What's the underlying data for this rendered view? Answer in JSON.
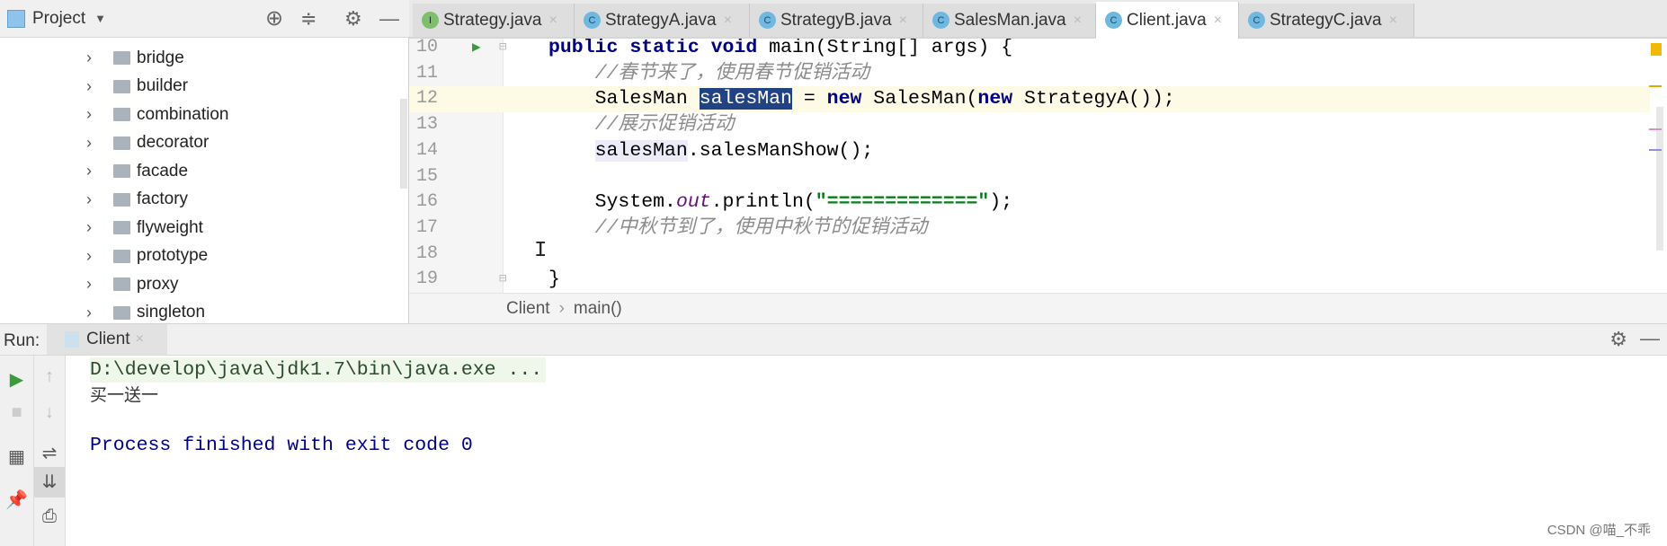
{
  "project": {
    "title": "Project",
    "tree": [
      "bridge",
      "builder",
      "combination",
      "decorator",
      "facade",
      "factory",
      "flyweight",
      "prototype",
      "proxy",
      "singleton"
    ]
  },
  "tabs": [
    {
      "label": "Strategy.java",
      "icon": "I"
    },
    {
      "label": "StrategyA.java",
      "icon": "C"
    },
    {
      "label": "StrategyB.java",
      "icon": "C"
    },
    {
      "label": "SalesMan.java",
      "icon": "C"
    },
    {
      "label": "Client.java",
      "icon": "C",
      "active": true
    },
    {
      "label": "StrategyC.java",
      "icon": "C"
    }
  ],
  "editor": {
    "lines": [
      "10",
      "11",
      "12",
      "13",
      "14",
      "15",
      "16",
      "17",
      "18",
      "19"
    ],
    "l10": {
      "kw": "public static void",
      "rest": " main(String[] args) {"
    },
    "l11": "//春节来了，使用春节促销活动",
    "l12": {
      "a": "SalesMan ",
      "sel": "salesMan",
      "b": " = ",
      "new1": "new",
      "c": " SalesMan(",
      "new2": "new",
      "d": " StrategyA());"
    },
    "l13": "//展示促销活动",
    "l14": {
      "u": "salesMan",
      "rest": ".salesManShow();"
    },
    "l16": {
      "a": "System.",
      "out": "out",
      "b": ".println(",
      "s": "\"=============\"",
      "c": ");"
    },
    "l17": "//中秋节到了，使用中秋节的促销活动",
    "l19": "}"
  },
  "breadcrumb": [
    "Client",
    "main()"
  ],
  "run": {
    "label": "Run:",
    "tab": "Client"
  },
  "console": [
    "D:\\develop\\java\\jdk1.7\\bin\\java.exe ...",
    "买一送一",
    "Process finished with exit code 0"
  ],
  "watermark": "CSDN @喵_不乖",
  "colors": {
    "keyword": "#000080",
    "comment": "#8c8c8c",
    "string": "#067d17",
    "selection": "#214283",
    "run": "#3a9b3a"
  }
}
